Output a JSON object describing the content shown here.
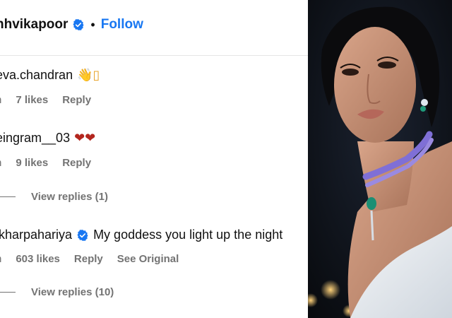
{
  "header": {
    "username": "nhvikapoor",
    "separator": "•",
    "follow_label": "Follow"
  },
  "comments": [
    {
      "username": "eva.chandran",
      "text": "👋▯",
      "time": "h",
      "likes": "7 likes",
      "reply_label": "Reply"
    },
    {
      "username": "eingram__03",
      "text": "❤❤",
      "time": "h",
      "likes": "9 likes",
      "reply_label": "Reply",
      "view_replies": "View replies (1)"
    },
    {
      "username": "ikharpahariya",
      "text": "My goddess you light up the night",
      "time": "h",
      "likes": "603 likes",
      "reply_label": "Reply",
      "see_original": "See Original",
      "view_replies": "View replies (10)"
    }
  ],
  "colors": {
    "accent": "#1877f2",
    "muted": "#737373",
    "heart": "#b3261e"
  },
  "icons": {
    "verified": "verified-badge-icon"
  }
}
